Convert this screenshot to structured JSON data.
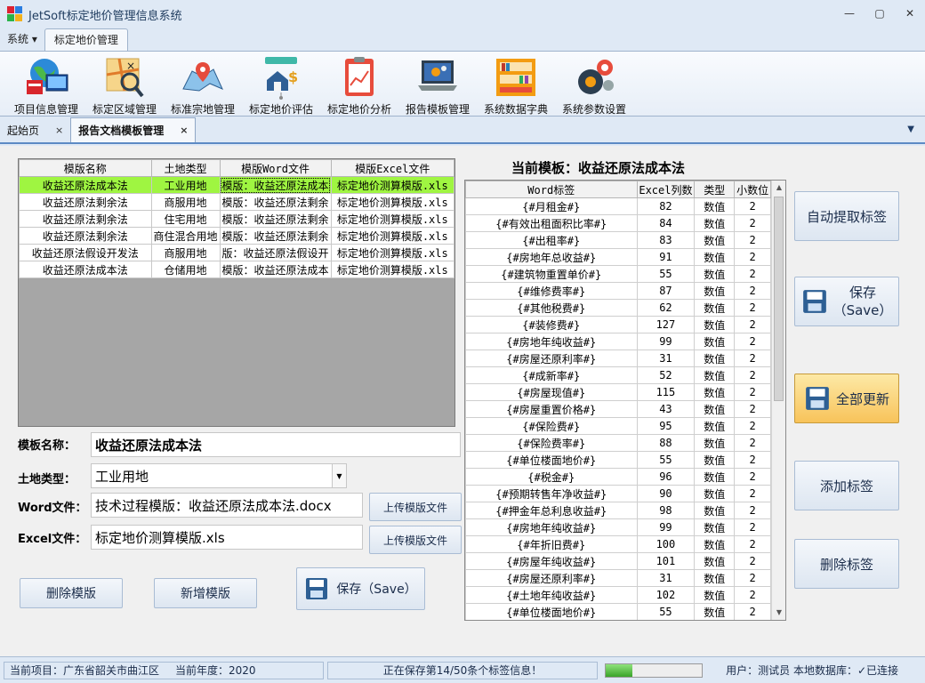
{
  "window": {
    "title": "JetSoft标定地价管理信息系统"
  },
  "menu": [
    {
      "label": "系统 ▾"
    },
    {
      "label": "标定地价管理",
      "active": true
    }
  ],
  "ribbon": [
    {
      "label": "项目信息管理",
      "icon": "globe-computer-icon"
    },
    {
      "label": "标定区域管理",
      "icon": "map-magnifier-icon"
    },
    {
      "label": "标准宗地管理",
      "icon": "map-pin-icon"
    },
    {
      "label": "标定地价评估",
      "icon": "house-price-icon"
    },
    {
      "label": "标定地价分析",
      "icon": "clipboard-chart-icon"
    },
    {
      "label": "报告模板管理",
      "icon": "laptop-gear-icon"
    },
    {
      "label": "系统数据字典",
      "icon": "bookshelf-icon"
    },
    {
      "label": "系统参数设置",
      "icon": "gears-icon"
    }
  ],
  "doctabs": [
    {
      "label": "起始页",
      "close": "×"
    },
    {
      "label": "报告文档模板管理",
      "close": "×",
      "active": true
    }
  ],
  "template_table": {
    "columns": [
      "模版名称",
      "土地类型",
      "模版Word文件",
      "模版Excel文件"
    ],
    "rows": [
      [
        "收益还原法成本法",
        "工业用地",
        "模版：收益还原法成本",
        "标定地价测算模版.xls"
      ],
      [
        "收益还原法剩余法",
        "商服用地",
        "模版：收益还原法剩余",
        "标定地价测算模版.xls"
      ],
      [
        "收益还原法剩余法",
        "住宅用地",
        "模版：收益还原法剩余",
        "标定地价测算模版.xls"
      ],
      [
        "收益还原法剩余法",
        "商住混合用地",
        "模版：收益还原法剩余",
        "标定地价测算模版.xls"
      ],
      [
        "收益还原法假设开发法",
        "商服用地",
        "版：收益还原法假设开",
        "标定地价测算模版.xls"
      ],
      [
        "收益还原法成本法",
        "仓储用地",
        "模版：收益还原法成本",
        "标定地价测算模版.xls"
      ]
    ]
  },
  "form": {
    "name_label": "模板名称：",
    "name_value": "收益还原法成本法",
    "land_label": "土地类型：",
    "land_value": "工业用地",
    "word_label": "Word文件：",
    "word_value": "技术过程模版：收益还原法成本法.docx",
    "excel_label": "Excel文件：",
    "excel_value": "标定地价测算模版.xls",
    "upload_label": "上传模版文件",
    "delete_label": "删除模版",
    "add_label": "新增模版",
    "save_label": "保存（Save）"
  },
  "current": {
    "title": "当前模板：收益还原法成本法",
    "columns": [
      "Word标签",
      "Excel列数",
      "类型",
      "小数位"
    ],
    "rows": [
      [
        "{#月租金#}",
        "82",
        "数值",
        "2"
      ],
      [
        "{#有效出租面积比率#}",
        "84",
        "数值",
        "2"
      ],
      [
        "{#出租率#}",
        "83",
        "数值",
        "2"
      ],
      [
        "{#房地年总收益#}",
        "91",
        "数值",
        "2"
      ],
      [
        "{#建筑物重置单价#}",
        "55",
        "数值",
        "2"
      ],
      [
        "{#维修费率#}",
        "87",
        "数值",
        "2"
      ],
      [
        "{#其他税费#}",
        "62",
        "数值",
        "2"
      ],
      [
        "{#装修费#}",
        "127",
        "数值",
        "2"
      ],
      [
        "{#房地年纯收益#}",
        "99",
        "数值",
        "2"
      ],
      [
        "{#房屋还原利率#}",
        "31",
        "数值",
        "2"
      ],
      [
        "{#成新率#}",
        "52",
        "数值",
        "2"
      ],
      [
        "{#房屋现值#}",
        "115",
        "数值",
        "2"
      ],
      [
        "{#房屋重置价格#}",
        "43",
        "数值",
        "2"
      ],
      [
        "{#保险费#}",
        "95",
        "数值",
        "2"
      ],
      [
        "{#保险费率#}",
        "88",
        "数值",
        "2"
      ],
      [
        "{#单位楼面地价#}",
        "55",
        "数值",
        "2"
      ],
      [
        "{#税金#}",
        "96",
        "数值",
        "2"
      ],
      [
        "{#预期转售年净收益#}",
        "90",
        "数值",
        "2"
      ],
      [
        "{#押金年总利息收益#}",
        "98",
        "数值",
        "2"
      ],
      [
        "{#房地年纯收益#}",
        "99",
        "数值",
        "2"
      ],
      [
        "{#年折旧费#}",
        "100",
        "数值",
        "2"
      ],
      [
        "{#房屋年纯收益#}",
        "101",
        "数值",
        "2"
      ],
      [
        "{#房屋还原利率#}",
        "31",
        "数值",
        "2"
      ],
      [
        "{#土地年纯收益#}",
        "102",
        "数值",
        "2"
      ],
      [
        "{#单位楼面地价#}",
        "55",
        "数值",
        "2"
      ]
    ]
  },
  "side_buttons": {
    "auto": "自动提取标签",
    "save_line1": "保存",
    "save_line2": "（Save）",
    "update": "全部更新",
    "add": "添加标签",
    "delete": "删除标签"
  },
  "status": {
    "project": "当前项目：广东省韶关市曲江区",
    "year": "当前年度：2020",
    "message": "正在保存第14/50条个标签信息！",
    "progress": 0.28,
    "user": "用户：测试员  本地数据库：✓已连接"
  },
  "colors": {
    "selected_row": "#9ff541",
    "accent": "#5d8ac4",
    "highlight_button": "#f8c35a"
  }
}
